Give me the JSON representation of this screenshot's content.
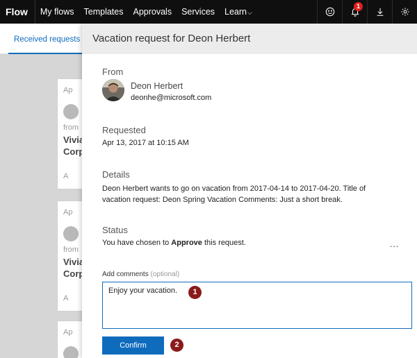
{
  "topbar": {
    "brand": "Flow",
    "nav": [
      {
        "label": "My flows"
      },
      {
        "label": "Templates"
      },
      {
        "label": "Approvals"
      },
      {
        "label": "Services"
      },
      {
        "label": "Learn"
      }
    ],
    "notification_count": "1",
    "icons": [
      "smiley-icon",
      "bell-icon",
      "download-icon",
      "gear-icon"
    ]
  },
  "background": {
    "tab_received": "Received requests",
    "card_text": {
      "row1": "Ap",
      "row2": "from",
      "row3": "Vivia",
      "row4": "Corp",
      "row5": "A"
    }
  },
  "panel": {
    "title": "Vacation request for Deon Herbert",
    "from_label": "From",
    "sender_name": "Deon Herbert",
    "sender_email": "deonhe@microsoft.com",
    "requested_label": "Requested",
    "requested_value": "Apr 13, 2017 at 10:15 AM",
    "details_label": "Details",
    "details_text": "Deon Herbert wants to go on vacation from 2017-04-14 to 2017-04-20. Title of vacation request: Deon Spring Vacation Comments: Just a short break.",
    "status_label": "Status",
    "status_prefix": "You have chosen to ",
    "status_action": "Approve",
    "status_suffix": " this request.",
    "more_label": "…",
    "comments_label": "Add comments",
    "comments_optional": "(optional)",
    "comments_value": "Enjoy your vacation.",
    "confirm_label": "Confirm"
  },
  "callouts": [
    "1",
    "2"
  ],
  "colors": {
    "accent": "#0f6cbd",
    "topbar": "#0f0f0f",
    "callout": "#8b1a1a",
    "badge": "#e02020"
  }
}
